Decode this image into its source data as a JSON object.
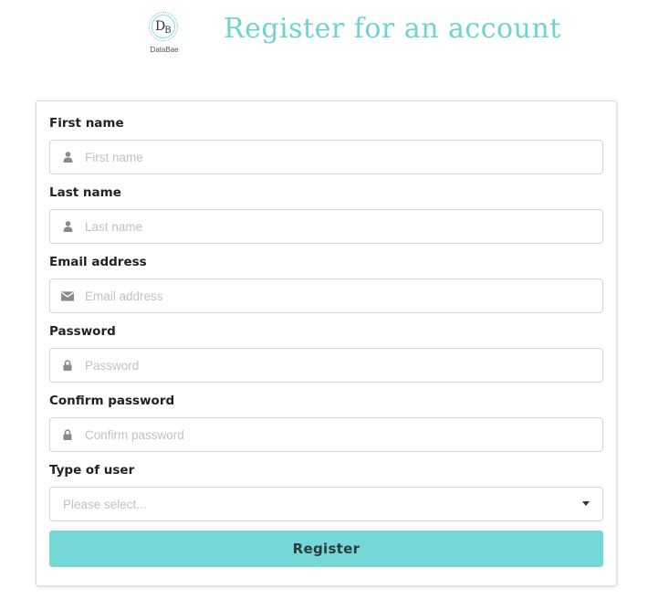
{
  "header": {
    "logo_letters_big": "D",
    "logo_letters_small": "B",
    "logo_text": "DataBae",
    "title": "Register for an account"
  },
  "form": {
    "fields": [
      {
        "label": "First name",
        "placeholder": "First name",
        "value": "",
        "icon": "user-icon"
      },
      {
        "label": "Last name",
        "placeholder": "Last name",
        "value": "",
        "icon": "user-icon"
      },
      {
        "label": "Email address",
        "placeholder": "Email address",
        "value": "",
        "icon": "envelope-icon"
      },
      {
        "label": "Password",
        "placeholder": "Password",
        "value": "",
        "icon": "lock-icon"
      },
      {
        "label": "Confirm password",
        "placeholder": "Confirm password",
        "value": "",
        "icon": "lock-icon"
      }
    ],
    "user_type": {
      "label": "Type of user",
      "placeholder": "Please select...",
      "value": "",
      "icon": "chevron-down-icon"
    },
    "submit_label": "Register"
  },
  "colors": {
    "accent": "#73d8d6",
    "title": "#6ed3d3",
    "border": "#d4d4d4",
    "icon": "#8a8a8a"
  }
}
